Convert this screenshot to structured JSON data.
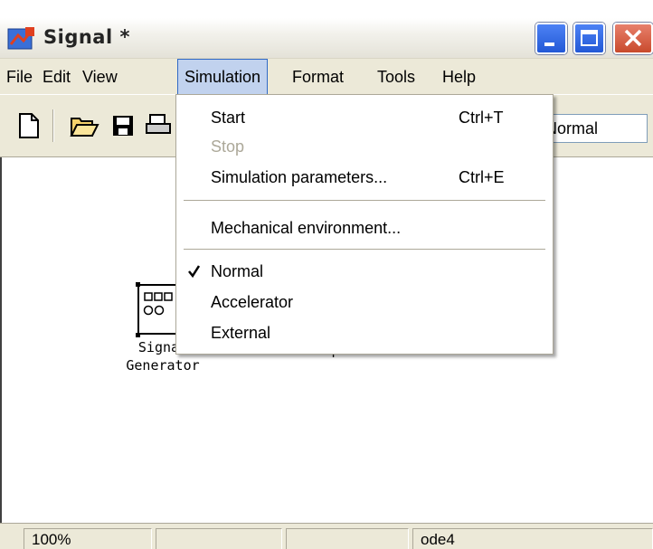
{
  "window": {
    "title": "Signal *"
  },
  "menubar": {
    "items": [
      "File",
      "Edit",
      "View",
      "Simulation",
      "Format",
      "Tools",
      "Help"
    ],
    "open_menu": "Simulation"
  },
  "toolbar": {
    "mode_value": "Normal",
    "tools": [
      "new-icon",
      "open-icon",
      "save-icon",
      "print-icon"
    ]
  },
  "canvas": {
    "blocks": [
      {
        "name": "signal-generator-block",
        "label_line1": "Signal",
        "label_line2": "Generator"
      },
      {
        "name": "scope-block",
        "label_line1": "Scope"
      }
    ]
  },
  "dropdown": {
    "items": [
      {
        "label": "Start",
        "shortcut": "Ctrl+T",
        "enabled": true
      },
      {
        "label": "Stop",
        "shortcut": "",
        "enabled": false
      },
      {
        "label": "Simulation parameters...",
        "shortcut": "Ctrl+E",
        "enabled": true
      },
      {
        "label": "Mechanical environment...",
        "shortcut": "",
        "enabled": true
      },
      {
        "label": "Normal",
        "shortcut": "",
        "enabled": true,
        "checked": true
      },
      {
        "label": "Accelerator",
        "shortcut": "",
        "enabled": true
      },
      {
        "label": "External",
        "shortcut": "",
        "enabled": true
      }
    ]
  },
  "statusbar": {
    "zoom": "100%",
    "cell2": "",
    "cell3": "",
    "solver": "ode4"
  },
  "colors": {
    "menu_highlight": "#c1d2ee",
    "window_face": "#ece9d8",
    "titlebar_close": "#c84a2c"
  }
}
